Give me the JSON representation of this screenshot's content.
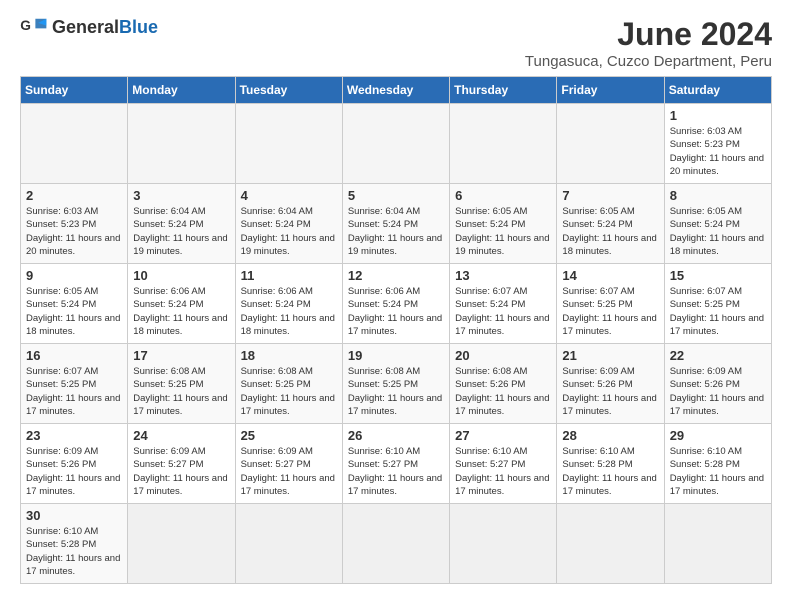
{
  "header": {
    "logo_general": "General",
    "logo_blue": "Blue",
    "title": "June 2024",
    "subtitle": "Tungasuca, Cuzco Department, Peru"
  },
  "weekdays": [
    "Sunday",
    "Monday",
    "Tuesday",
    "Wednesday",
    "Thursday",
    "Friday",
    "Saturday"
  ],
  "weeks": [
    [
      {
        "day": "",
        "empty": true
      },
      {
        "day": "",
        "empty": true
      },
      {
        "day": "",
        "empty": true
      },
      {
        "day": "",
        "empty": true
      },
      {
        "day": "",
        "empty": true
      },
      {
        "day": "",
        "empty": true
      },
      {
        "day": "1",
        "sunrise": "Sunrise: 6:03 AM",
        "sunset": "Sunset: 5:23 PM",
        "daylight": "Daylight: 11 hours and 20 minutes."
      }
    ],
    [
      {
        "day": "2",
        "sunrise": "Sunrise: 6:03 AM",
        "sunset": "Sunset: 5:23 PM",
        "daylight": "Daylight: 11 hours and 20 minutes."
      },
      {
        "day": "3",
        "sunrise": "Sunrise: 6:04 AM",
        "sunset": "Sunset: 5:24 PM",
        "daylight": "Daylight: 11 hours and 19 minutes."
      },
      {
        "day": "4",
        "sunrise": "Sunrise: 6:04 AM",
        "sunset": "Sunset: 5:24 PM",
        "daylight": "Daylight: 11 hours and 19 minutes."
      },
      {
        "day": "5",
        "sunrise": "Sunrise: 6:04 AM",
        "sunset": "Sunset: 5:24 PM",
        "daylight": "Daylight: 11 hours and 19 minutes."
      },
      {
        "day": "6",
        "sunrise": "Sunrise: 6:05 AM",
        "sunset": "Sunset: 5:24 PM",
        "daylight": "Daylight: 11 hours and 19 minutes."
      },
      {
        "day": "7",
        "sunrise": "Sunrise: 6:05 AM",
        "sunset": "Sunset: 5:24 PM",
        "daylight": "Daylight: 11 hours and 18 minutes."
      },
      {
        "day": "8",
        "sunrise": "Sunrise: 6:05 AM",
        "sunset": "Sunset: 5:24 PM",
        "daylight": "Daylight: 11 hours and 18 minutes."
      }
    ],
    [
      {
        "day": "9",
        "sunrise": "Sunrise: 6:05 AM",
        "sunset": "Sunset: 5:24 PM",
        "daylight": "Daylight: 11 hours and 18 minutes."
      },
      {
        "day": "10",
        "sunrise": "Sunrise: 6:06 AM",
        "sunset": "Sunset: 5:24 PM",
        "daylight": "Daylight: 11 hours and 18 minutes."
      },
      {
        "day": "11",
        "sunrise": "Sunrise: 6:06 AM",
        "sunset": "Sunset: 5:24 PM",
        "daylight": "Daylight: 11 hours and 18 minutes."
      },
      {
        "day": "12",
        "sunrise": "Sunrise: 6:06 AM",
        "sunset": "Sunset: 5:24 PM",
        "daylight": "Daylight: 11 hours and 17 minutes."
      },
      {
        "day": "13",
        "sunrise": "Sunrise: 6:07 AM",
        "sunset": "Sunset: 5:24 PM",
        "daylight": "Daylight: 11 hours and 17 minutes."
      },
      {
        "day": "14",
        "sunrise": "Sunrise: 6:07 AM",
        "sunset": "Sunset: 5:25 PM",
        "daylight": "Daylight: 11 hours and 17 minutes."
      },
      {
        "day": "15",
        "sunrise": "Sunrise: 6:07 AM",
        "sunset": "Sunset: 5:25 PM",
        "daylight": "Daylight: 11 hours and 17 minutes."
      }
    ],
    [
      {
        "day": "16",
        "sunrise": "Sunrise: 6:07 AM",
        "sunset": "Sunset: 5:25 PM",
        "daylight": "Daylight: 11 hours and 17 minutes."
      },
      {
        "day": "17",
        "sunrise": "Sunrise: 6:08 AM",
        "sunset": "Sunset: 5:25 PM",
        "daylight": "Daylight: 11 hours and 17 minutes."
      },
      {
        "day": "18",
        "sunrise": "Sunrise: 6:08 AM",
        "sunset": "Sunset: 5:25 PM",
        "daylight": "Daylight: 11 hours and 17 minutes."
      },
      {
        "day": "19",
        "sunrise": "Sunrise: 6:08 AM",
        "sunset": "Sunset: 5:25 PM",
        "daylight": "Daylight: 11 hours and 17 minutes."
      },
      {
        "day": "20",
        "sunrise": "Sunrise: 6:08 AM",
        "sunset": "Sunset: 5:26 PM",
        "daylight": "Daylight: 11 hours and 17 minutes."
      },
      {
        "day": "21",
        "sunrise": "Sunrise: 6:09 AM",
        "sunset": "Sunset: 5:26 PM",
        "daylight": "Daylight: 11 hours and 17 minutes."
      },
      {
        "day": "22",
        "sunrise": "Sunrise: 6:09 AM",
        "sunset": "Sunset: 5:26 PM",
        "daylight": "Daylight: 11 hours and 17 minutes."
      }
    ],
    [
      {
        "day": "23",
        "sunrise": "Sunrise: 6:09 AM",
        "sunset": "Sunset: 5:26 PM",
        "daylight": "Daylight: 11 hours and 17 minutes."
      },
      {
        "day": "24",
        "sunrise": "Sunrise: 6:09 AM",
        "sunset": "Sunset: 5:27 PM",
        "daylight": "Daylight: 11 hours and 17 minutes."
      },
      {
        "day": "25",
        "sunrise": "Sunrise: 6:09 AM",
        "sunset": "Sunset: 5:27 PM",
        "daylight": "Daylight: 11 hours and 17 minutes."
      },
      {
        "day": "26",
        "sunrise": "Sunrise: 6:10 AM",
        "sunset": "Sunset: 5:27 PM",
        "daylight": "Daylight: 11 hours and 17 minutes."
      },
      {
        "day": "27",
        "sunrise": "Sunrise: 6:10 AM",
        "sunset": "Sunset: 5:27 PM",
        "daylight": "Daylight: 11 hours and 17 minutes."
      },
      {
        "day": "28",
        "sunrise": "Sunrise: 6:10 AM",
        "sunset": "Sunset: 5:28 PM",
        "daylight": "Daylight: 11 hours and 17 minutes."
      },
      {
        "day": "29",
        "sunrise": "Sunrise: 6:10 AM",
        "sunset": "Sunset: 5:28 PM",
        "daylight": "Daylight: 11 hours and 17 minutes."
      }
    ],
    [
      {
        "day": "30",
        "sunrise": "Sunrise: 6:10 AM",
        "sunset": "Sunset: 5:28 PM",
        "daylight": "Daylight: 11 hours and 17 minutes."
      },
      {
        "day": "",
        "empty": true
      },
      {
        "day": "",
        "empty": true
      },
      {
        "day": "",
        "empty": true
      },
      {
        "day": "",
        "empty": true
      },
      {
        "day": "",
        "empty": true
      },
      {
        "day": "",
        "empty": true
      }
    ]
  ]
}
